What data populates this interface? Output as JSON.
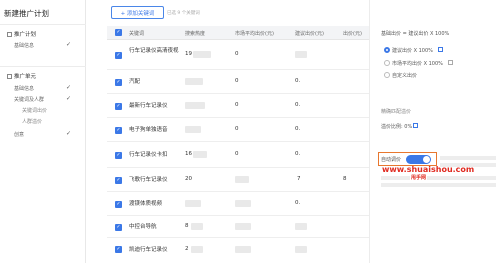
{
  "sidebar": {
    "title": "新建推广计划",
    "plan_group": "推广计划",
    "plan_items": [
      {
        "label": "基础信息",
        "done": true
      }
    ],
    "unit_group": "推广单元",
    "unit_items": [
      {
        "label": "基础信息",
        "done": true
      },
      {
        "label": "关键词及人群",
        "done": true
      },
      {
        "label": "创意",
        "done": true
      }
    ],
    "unit_subitems": [
      "关键词出价",
      "人群溢价"
    ],
    "check_glyph": "✓"
  },
  "toolbar": {
    "add_keyword_label": "+ 添加关键词",
    "hint": "已选 9 个关键词"
  },
  "table": {
    "headers": [
      "关键词",
      "搜索热度",
      "市场平均出价(元)",
      "建议出价(元)",
      "出价(元)"
    ],
    "rows": [
      {
        "keyword": "行车记录仪高清夜视",
        "heat": "19",
        "avg": "0",
        "suggest": "",
        "bid": ""
      },
      {
        "keyword": "汽配",
        "heat": "",
        "avg": "0",
        "suggest": "0.",
        "bid": ""
      },
      {
        "keyword": "最新行车记录仪",
        "heat": "",
        "avg": "0",
        "suggest": "0.",
        "bid": ""
      },
      {
        "keyword": "电子狗单独语音",
        "heat": "",
        "avg": "0",
        "suggest": "0.",
        "bid": ""
      },
      {
        "keyword": "行车记录仪卡扣",
        "heat": "16",
        "avg": "0",
        "suggest": "0.",
        "bid": ""
      },
      {
        "keyword": "飞歌行车记录仪",
        "heat": "20",
        "avg": "",
        "suggest": "7",
        "bid": "8"
      },
      {
        "keyword": "渡镁体质视频",
        "heat": "",
        "avg": "",
        "suggest": "0.",
        "bid": ""
      },
      {
        "keyword": "中控台导航",
        "heat": "8",
        "avg": "",
        "suggest": "",
        "bid": ""
      },
      {
        "keyword": "凯迪行车记录仪",
        "heat": "2",
        "avg": "",
        "suggest": "",
        "bid": ""
      }
    ]
  },
  "right_panel": {
    "formula": "基础出价 = 建议出价 X 100%",
    "options": [
      {
        "label": "建议出价 X 100%",
        "selected": true
      },
      {
        "label": "市场平均出价 X 100%",
        "selected": false
      },
      {
        "label": "自定义出价",
        "selected": false
      }
    ],
    "smart_section_title": "精确匹配溢价",
    "premium_label": "溢价比例: 0%",
    "auto_bid_label": "自动调价",
    "auto_bid_on": true
  },
  "watermark": {
    "domain": "www.shuaishou.com",
    "cn": "甩手网"
  },
  "colors": {
    "accent": "#3b78e7",
    "highlight": "#e8772e",
    "watermark": "#e02a20"
  }
}
